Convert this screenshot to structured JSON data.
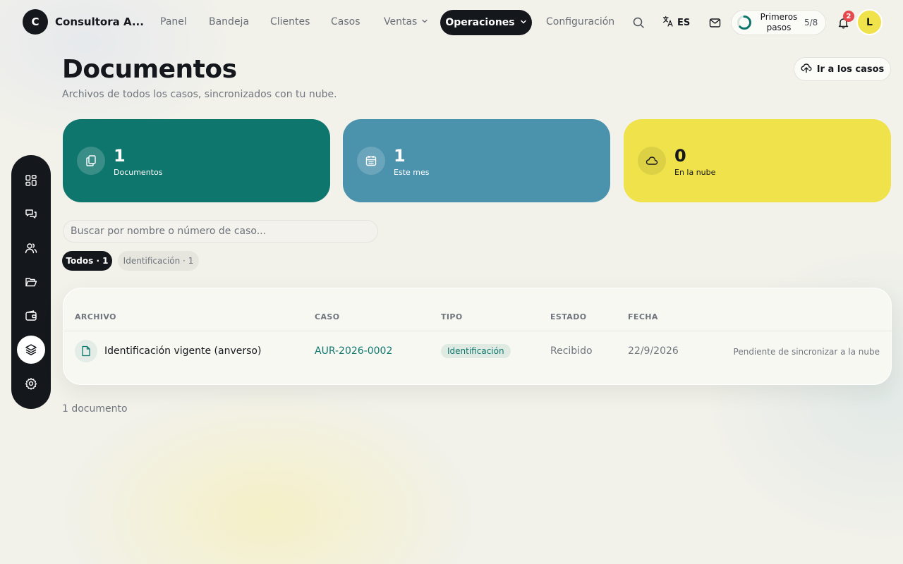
{
  "brand": {
    "initial": "C",
    "name": "Consultora A..."
  },
  "nav": {
    "panel": "Panel",
    "bandeja": "Bandeja",
    "clientes": "Clientes",
    "casos": "Casos",
    "ventas": "Ventas",
    "operaciones": "Operaciones",
    "configuracion": "Configuración"
  },
  "language": "ES",
  "onboarding": {
    "label": "Primeros pasos",
    "progress": "5/8",
    "fraction": 0.625
  },
  "notifications": {
    "count": "2"
  },
  "user": {
    "initial": "L"
  },
  "rail": {
    "items": [
      "dashboard-icon",
      "chat-icon",
      "users-icon",
      "folder-icon",
      "wallet-icon",
      "layers-icon",
      "gear-icon"
    ],
    "active": "layers-icon"
  },
  "page": {
    "title": "Documentos",
    "subtitle": "Archivos de todos los casos, sincronizados con tu nube.",
    "go_cases": "Ir a los casos"
  },
  "stats": [
    {
      "value": "1",
      "label": "Documentos",
      "color": "#0f766e",
      "icon": "files-icon"
    },
    {
      "value": "1",
      "label": "Este mes",
      "color": "#4b92ad",
      "icon": "calendar-icon"
    },
    {
      "value": "0",
      "label": "En la nube",
      "color": "#efe24b",
      "icon": "cloud-icon"
    }
  ],
  "search": {
    "placeholder": "Buscar por nombre o número de caso...",
    "value": ""
  },
  "filters": [
    {
      "label": "Todos · 1",
      "active": true
    },
    {
      "label": "Identificación · 1",
      "active": false
    }
  ],
  "table": {
    "columns": [
      "ARCHIVO",
      "CASO",
      "TIPO",
      "ESTADO",
      "FECHA"
    ],
    "rows": [
      {
        "file": "Identificación vigente (anverso)",
        "case": "AUR-2026-0002",
        "type": "Identificación",
        "state": "Recibido",
        "date": "22/9/2026",
        "sync": "Pendiente de sincronizar a la nube"
      }
    ]
  },
  "footer": {
    "count": "1 documento"
  },
  "colors": {
    "accent": "#14171c",
    "teal": "#0f766e",
    "blue": "#4b92ad",
    "yellow": "#efe24b",
    "badge": "#e5484d"
  }
}
